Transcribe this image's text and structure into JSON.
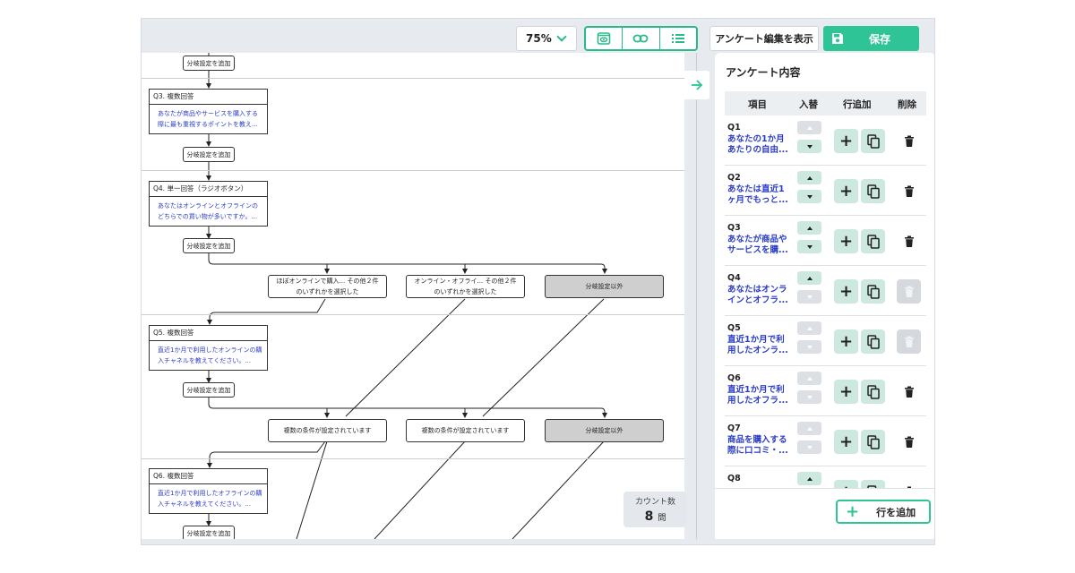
{
  "toolbar": {
    "zoom_value": "75%",
    "preview_label": "アンケート編集を表示",
    "save_label": "保存"
  },
  "flow": {
    "add_branch_label": "分岐設定を追加",
    "questions": [
      {
        "title": "Q3. 複数回答",
        "desc1": "あなたが商品やサービスを購入する",
        "desc2": "際に最も重視するポイントを教え..."
      },
      {
        "title": "Q4. 単一回答（ラジオボタン）",
        "desc1": "あなたはオンラインとオフラインの",
        "desc2": "どちらでの買い物が多いですか。..."
      },
      {
        "title": "Q5. 複数回答",
        "desc1": "直近1か月で利用したオンラインの購",
        "desc2": "入チャネルを教えてください。..."
      },
      {
        "title": "Q6. 複数回答",
        "desc1": "直近1か月で利用したオフラインの購",
        "desc2": "入チャネルを教えてください。..."
      }
    ],
    "q4_conditions": [
      {
        "line1": "ほぼオンラインで購入... その他２件",
        "line2": "のいずれかを選択した"
      },
      {
        "line1": "オンライン・オフライ... その他２件",
        "line2": "のいずれかを選択した"
      },
      {
        "line1": "分岐設定以外",
        "line2": ""
      }
    ],
    "q5_conditions": [
      {
        "line1": "複数の条件が設定されています",
        "line2": ""
      },
      {
        "line1": "複数の条件が設定されています",
        "line2": ""
      },
      {
        "line1": "分岐設定以外",
        "line2": ""
      }
    ],
    "count": {
      "label": "カウント数",
      "value": "8",
      "unit": "問"
    }
  },
  "panel": {
    "title": "アンケート内容",
    "headers": {
      "item": "項目",
      "swap": "入替",
      "add_row": "行追加",
      "delete": "削除"
    },
    "rows": [
      {
        "num": "Q1",
        "l1": "あなたの1か月",
        "l2": "あたりの自由...",
        "up": false,
        "down": true,
        "del": true
      },
      {
        "num": "Q2",
        "l1": "あなたは直近1",
        "l2": "ヶ月でもっと...",
        "up": true,
        "down": true,
        "del": true
      },
      {
        "num": "Q3",
        "l1": "あなたが商品や",
        "l2": "サービスを購...",
        "up": true,
        "down": true,
        "del": true
      },
      {
        "num": "Q4",
        "l1": "あなたはオンラ",
        "l2": "インとオフラ...",
        "up": true,
        "down": false,
        "del": false
      },
      {
        "num": "Q5",
        "l1": "直近1か月で利",
        "l2": "用したオンラ...",
        "up": false,
        "down": false,
        "del": false
      },
      {
        "num": "Q6",
        "l1": "直近1か月で利",
        "l2": "用したオフラ...",
        "up": false,
        "down": false,
        "del": true
      },
      {
        "num": "Q7",
        "l1": "商品を購入する",
        "l2": "際に口コミ・...",
        "up": false,
        "down": false,
        "del": true
      },
      {
        "num": "Q8",
        "l1": "",
        "l2": "",
        "up": true,
        "down": true,
        "del": true
      }
    ],
    "add_row_label": "行を追加"
  },
  "colors": {
    "accent": "#2fc496",
    "link_text": "#2a3bc8",
    "condition_gray": "#cfcfcf"
  }
}
